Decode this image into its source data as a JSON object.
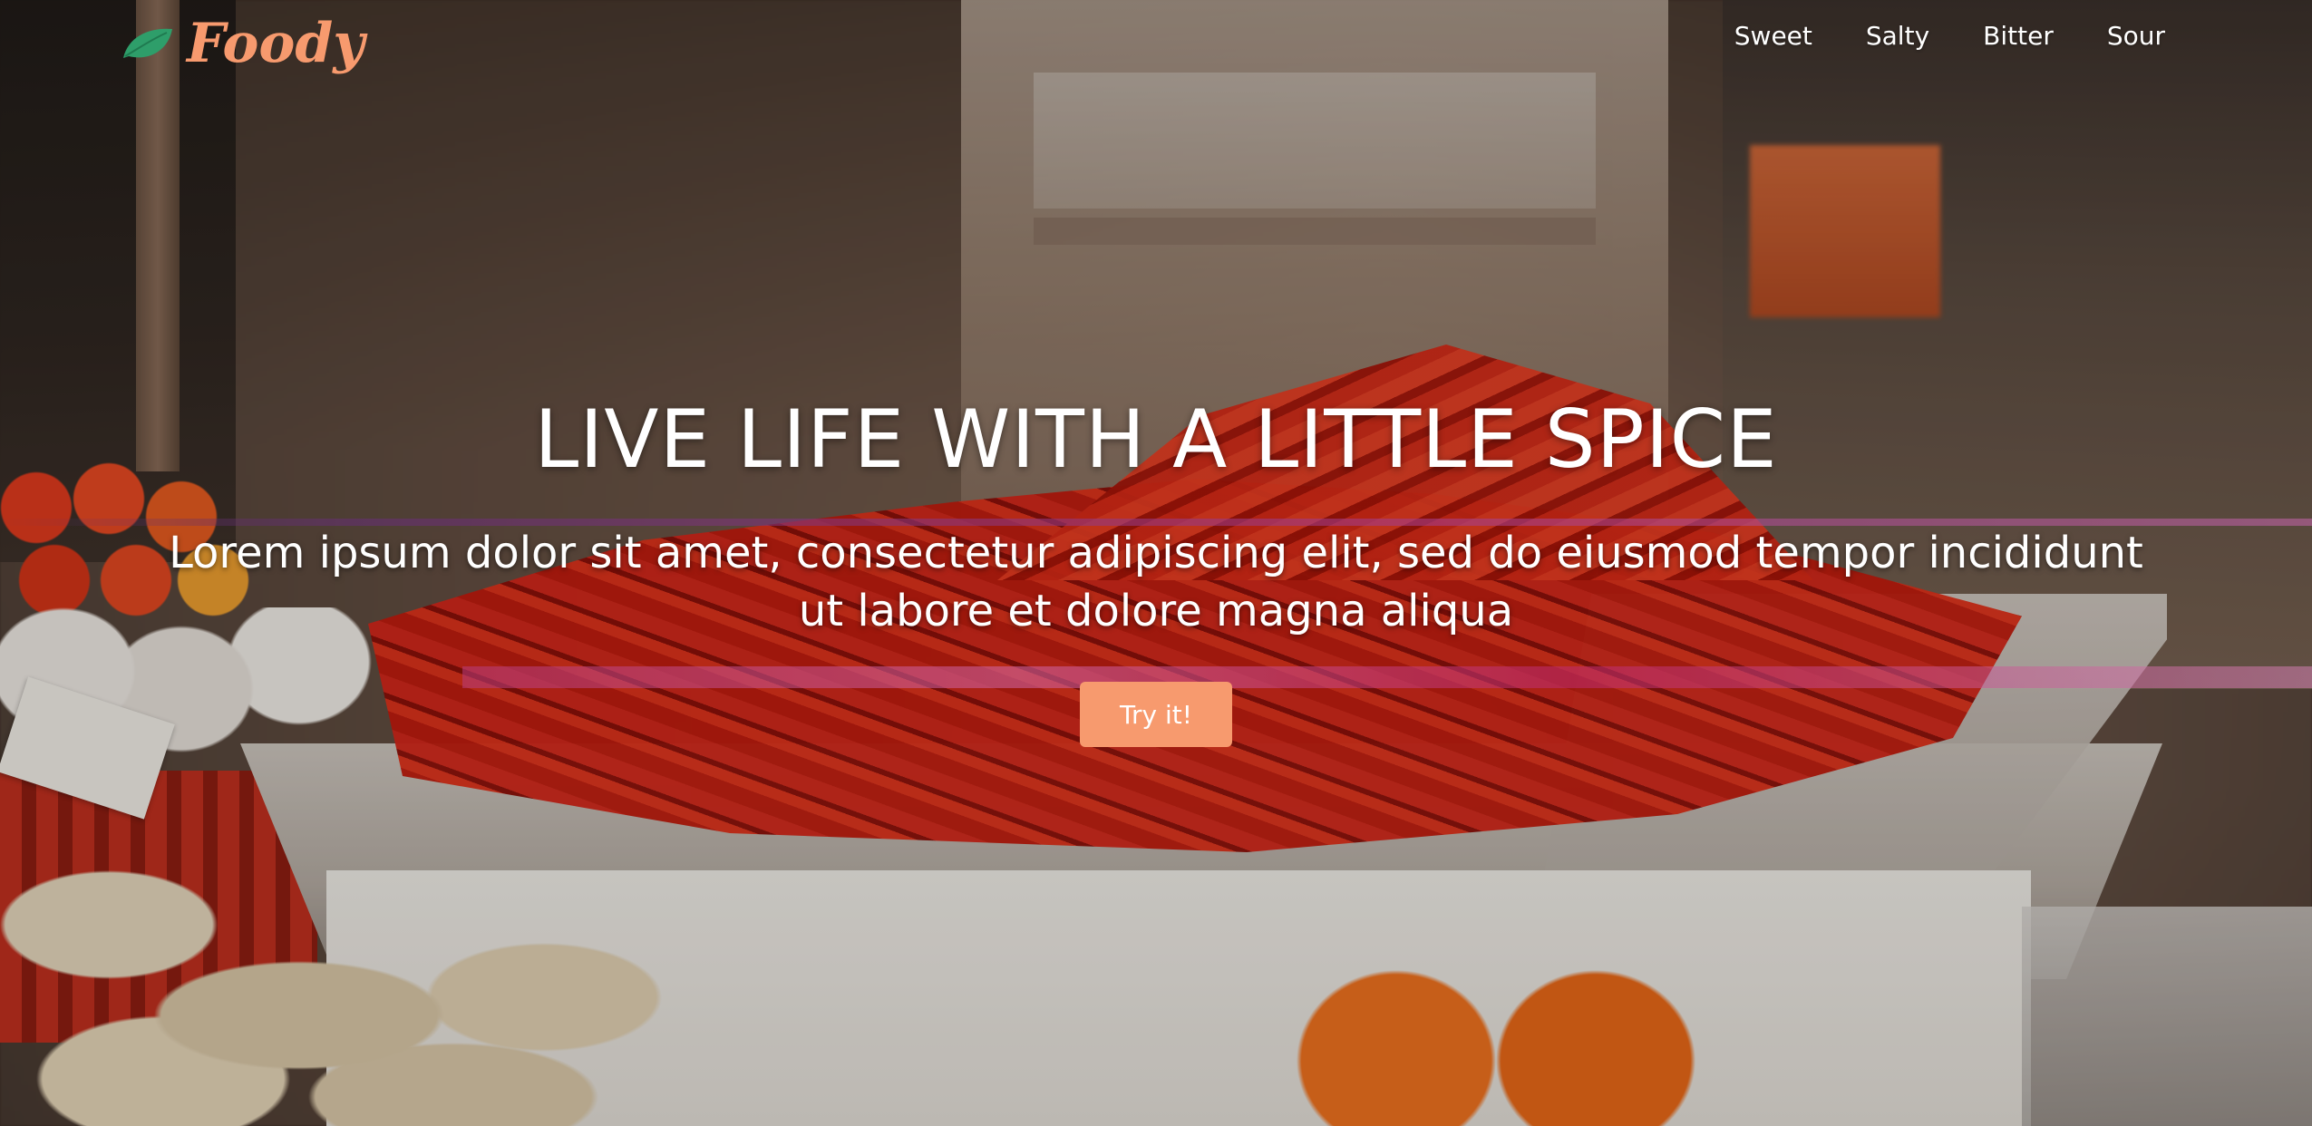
{
  "brand": {
    "name": "Foody",
    "logo_icon": "leaf-icon",
    "colors": {
      "accent": "#f79a6e",
      "leaf": "#2e9e6a",
      "text": "#ffffff"
    }
  },
  "nav": {
    "items": [
      {
        "label": "Sweet"
      },
      {
        "label": "Salty"
      },
      {
        "label": "Bitter"
      },
      {
        "label": "Sour"
      }
    ]
  },
  "hero": {
    "headline": "LIVE LIFE WITH A LITTLE SPICE",
    "subtitle": "Lorem ipsum dolor sit amet, consectetur adipiscing elit, sed do eiusmod tempor incididunt ut labore et dolore magna aliqua",
    "cta_label": "Try it!"
  }
}
